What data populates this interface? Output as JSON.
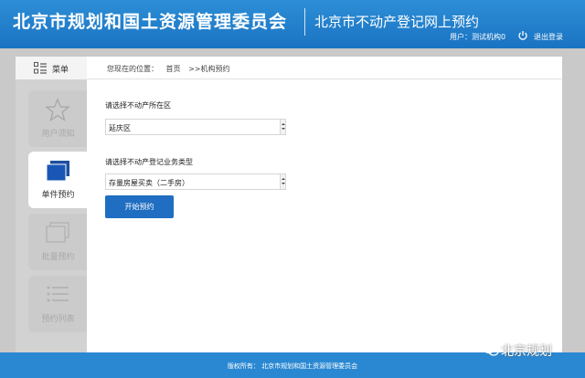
{
  "header": {
    "org_title": "北京市规划和国土资源管理委员会",
    "system_title": "北京市不动产登记网上预约",
    "user_label": "用户：测试机构0",
    "logout_label": "退出登录"
  },
  "sidebar": {
    "menu_label": "菜单",
    "items": [
      {
        "label": "用户须知",
        "icon": "star-icon",
        "active": false
      },
      {
        "label": "单件预约",
        "icon": "single-booking-icon",
        "active": true
      },
      {
        "label": "批量预约",
        "icon": "batch-booking-icon",
        "active": false
      },
      {
        "label": "预约列表",
        "icon": "list-icon",
        "active": false
      }
    ]
  },
  "breadcrumb": {
    "prefix": "您现在的位置：",
    "home": "首页",
    "current": ">>机构预约"
  },
  "form": {
    "district_label": "请选择不动产所在区",
    "district_value": "延庆区",
    "business_label": "请选择不动产登记业务类型",
    "business_value": "存量房屋买卖（二手房）",
    "start_button": "开始预约"
  },
  "footer": {
    "copyright": "版权所有：  北京市规划和国土资源管理委员会"
  },
  "watermark": {
    "text": "北京规划"
  },
  "colors": {
    "header_blue": "#1a73c2",
    "button_blue": "#1f6ec1",
    "footer_blue": "#2a88d2"
  }
}
